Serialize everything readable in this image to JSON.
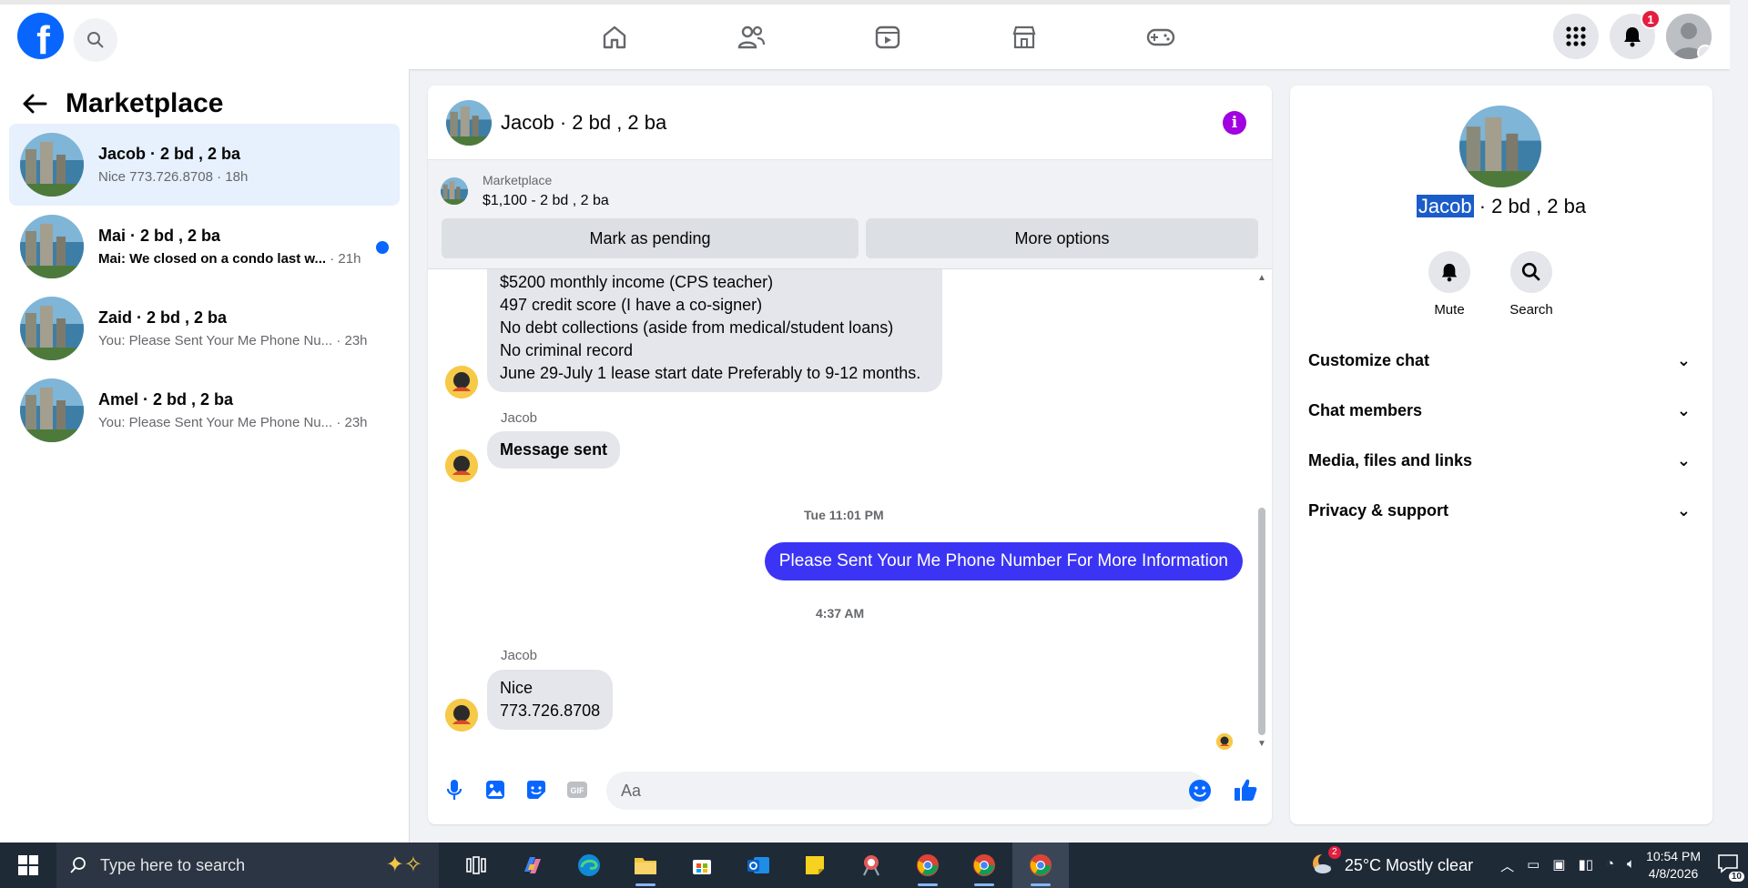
{
  "topbar": {
    "notifications_count": "1",
    "nav": [
      "home-icon",
      "friends-icon",
      "video-icon",
      "marketplace-icon",
      "gaming-icon"
    ]
  },
  "sidebar": {
    "title": "Marketplace",
    "conversations": [
      {
        "name": "Jacob · 2 bd , 2 ba",
        "preview": "Nice 773.726.8708",
        "time": "· 18h"
      },
      {
        "name": "Mai · 2 bd , 2 ba",
        "preview": "Mai: We closed on a condo last w...",
        "time": "· 21h"
      },
      {
        "name": "Zaid · 2 bd , 2 ba",
        "preview": "You: Please Sent Your Me Phone Nu...",
        "time": "· 23h"
      },
      {
        "name": "Amel · 2 bd , 2 ba",
        "preview": "You: Please Sent Your Me Phone Nu...",
        "time": "· 23h"
      }
    ]
  },
  "chat": {
    "title": "Jacob · 2 bd , 2 ba",
    "marketplace_label": "Marketplace",
    "listing": "$1,100 - 2 bd , 2 ba",
    "mark_pending": "Mark as pending",
    "more_options": "More options",
    "messages": {
      "first_lines": [
        "$5200 monthly income (CPS teacher)",
        "497 credit score (I have a co-signer)",
        "No debt collections (aside from medical/student loans)",
        "No criminal record",
        "June 29-July 1 lease start date Preferably to 9-12 months."
      ],
      "sender1": "Jacob",
      "sent_text": "Message sent",
      "time1": "Tue 11:01 PM",
      "outgoing": "Please Sent Your Me Phone Number For More Information",
      "time2": "4:37 AM",
      "sender2": "Jacob",
      "reply_line1": "Nice",
      "reply_line2": "773.726.8708"
    },
    "composer_placeholder": "Aa"
  },
  "info": {
    "name_highlight": "Jacob",
    "name_rest": " · 2 bd , 2 ba",
    "mute": "Mute",
    "search": "Search",
    "sections": [
      "Customize chat",
      "Chat members",
      "Media, files and links",
      "Privacy & support"
    ]
  },
  "taskbar": {
    "search_placeholder": "Type here to search",
    "weather_badge": "2",
    "weather": "25°C  Mostly clear",
    "time": "10:54 PM",
    "date": "4/8/2026",
    "notif_count": "10"
  },
  "colors": {
    "brand": "#0866ff",
    "outgoing_bubble": "#3b34f4",
    "info_button": "#a100e0",
    "active_conversation": "#e7f0fd"
  }
}
